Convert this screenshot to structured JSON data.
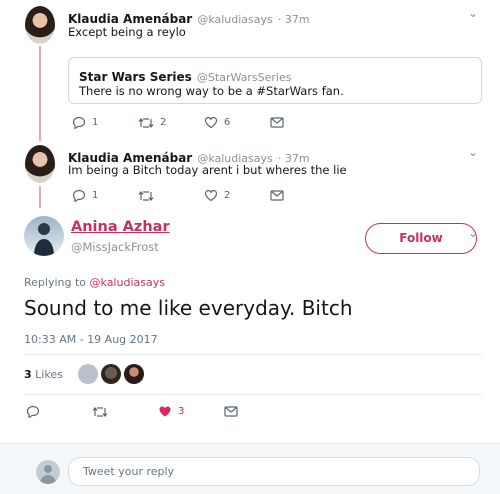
{
  "tweet1": {
    "name": "Klaudia Amenábar",
    "handle": "@kaludiasays",
    "time": "· 37m",
    "text": "Except being a reylo"
  },
  "quote": {
    "name": "Star Wars Series",
    "handle": "@StarWarsSeries",
    "text": "There is no wrong way to be a #StarWars fan."
  },
  "tweet1_actions": {
    "replies": "1",
    "retweets": "2",
    "likes": "6"
  },
  "tweet2": {
    "name": "Klaudia Amenábar",
    "handle": "@kaludiasays",
    "time": "· 37m",
    "text": "Im being a Bitch today arent i but wheres the lie"
  },
  "tweet2_actions": {
    "replies": "1",
    "retweets": "",
    "likes": "2"
  },
  "main": {
    "name": "Anina Azhar",
    "handle": "@MissJackFrost",
    "follow_label": "Follow",
    "replying_prefix": "Replying to",
    "replying_to": "@kaludiasays",
    "text": "Sound to me like everyday. Bitch",
    "timestamp": "10:33 AM - 19 Aug 2017",
    "likes_count": "3",
    "likes_label": "Likes",
    "like_action_count": "3"
  },
  "reply": {
    "placeholder": "Tweet your reply"
  },
  "colors": {
    "accent": "#c4335f",
    "thread": "#e1a7c5",
    "liked": "#e0245e"
  },
  "icons": [
    "reply-icon",
    "retweet-icon",
    "heart-icon",
    "message-icon",
    "chevron-down-icon"
  ]
}
